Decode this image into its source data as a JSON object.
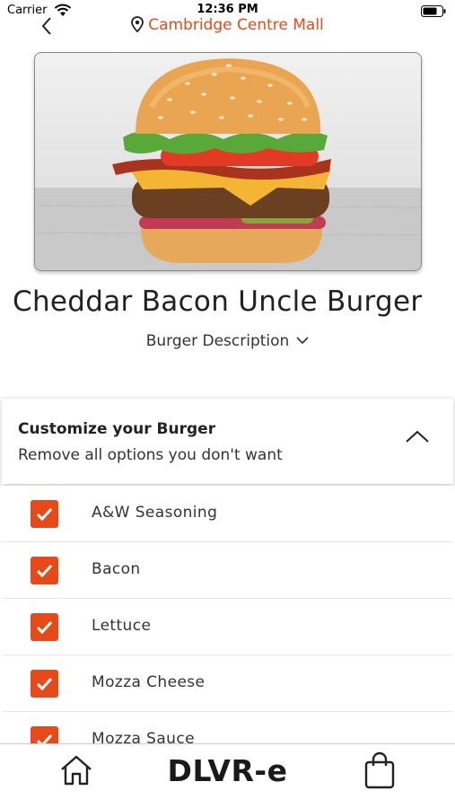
{
  "status_bar": {
    "carrier": "Carrier",
    "time": "12:36 PM"
  },
  "header": {
    "location": "Cambridge Centre Mall",
    "accent_color": "#e64a19"
  },
  "product": {
    "title": "Cheddar Bacon Uncle Burger",
    "description_toggle": "Burger Description"
  },
  "customize": {
    "title": "Customize your Burger",
    "subtitle": "Remove all options you don't want",
    "options": [
      {
        "label": "A&W Seasoning",
        "checked": true
      },
      {
        "label": "Bacon",
        "checked": true
      },
      {
        "label": "Lettuce",
        "checked": true
      },
      {
        "label": "Mozza Cheese",
        "checked": true
      },
      {
        "label": "Mozza Sauce",
        "checked": true
      }
    ]
  },
  "bottom_nav": {
    "brand": "DLVR-e"
  }
}
